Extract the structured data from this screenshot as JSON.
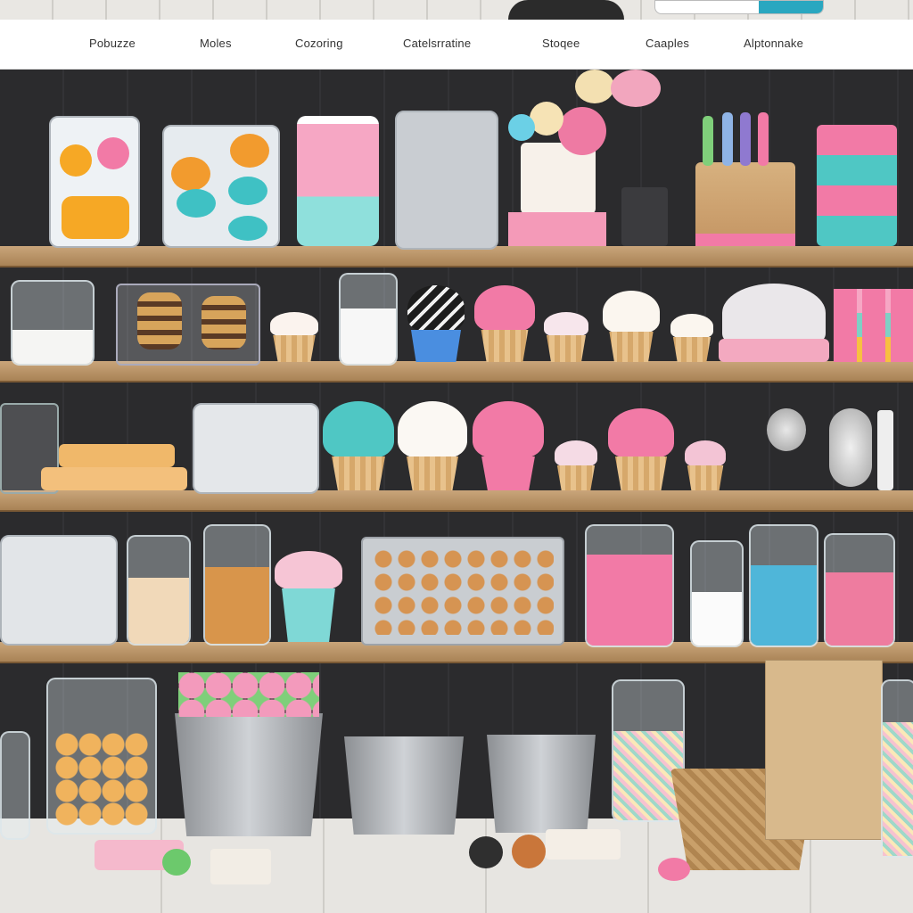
{
  "nav": {
    "items": [
      "Pobuzze",
      "Moles",
      "Cozoring",
      "Catelsrratine",
      "Stoqee",
      "Caaples",
      "Alptonnake"
    ]
  },
  "colors": {
    "nav_bg": "#ffffff",
    "accent": "#2aa7c0",
    "wall": "#2c2c2e",
    "shelf_wood": "#b8915f",
    "pink": "#f27aa6",
    "teal": "#5cc9c6"
  },
  "icons": [
    "lamp-icon"
  ]
}
